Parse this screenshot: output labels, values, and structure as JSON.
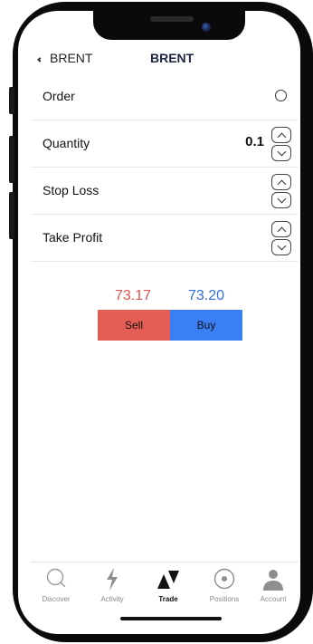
{
  "nav": {
    "back_label": "BRENT",
    "title": "BRENT"
  },
  "form": {
    "order_label": "Order",
    "quantity_label": "Quantity",
    "quantity_value": "0.1",
    "stop_loss_label": "Stop Loss",
    "take_profit_label": "Take Profit"
  },
  "prices": {
    "sell": "73.17",
    "buy": "73.20"
  },
  "buttons": {
    "sell_label": "Sell",
    "buy_label": "Buy"
  },
  "tabs": [
    {
      "label": "Discover",
      "icon": "search-icon"
    },
    {
      "label": "Activity",
      "icon": "bolt-icon"
    },
    {
      "label": "Trade",
      "icon": "trade-icon",
      "active": true
    },
    {
      "label": "Positions",
      "icon": "positions-icon"
    },
    {
      "label": "Account",
      "icon": "person-icon"
    }
  ],
  "colors": {
    "sell": "#e45e56",
    "buy": "#3a7ff6",
    "sell_text": "#e0534f",
    "buy_text": "#2f6fe0"
  }
}
